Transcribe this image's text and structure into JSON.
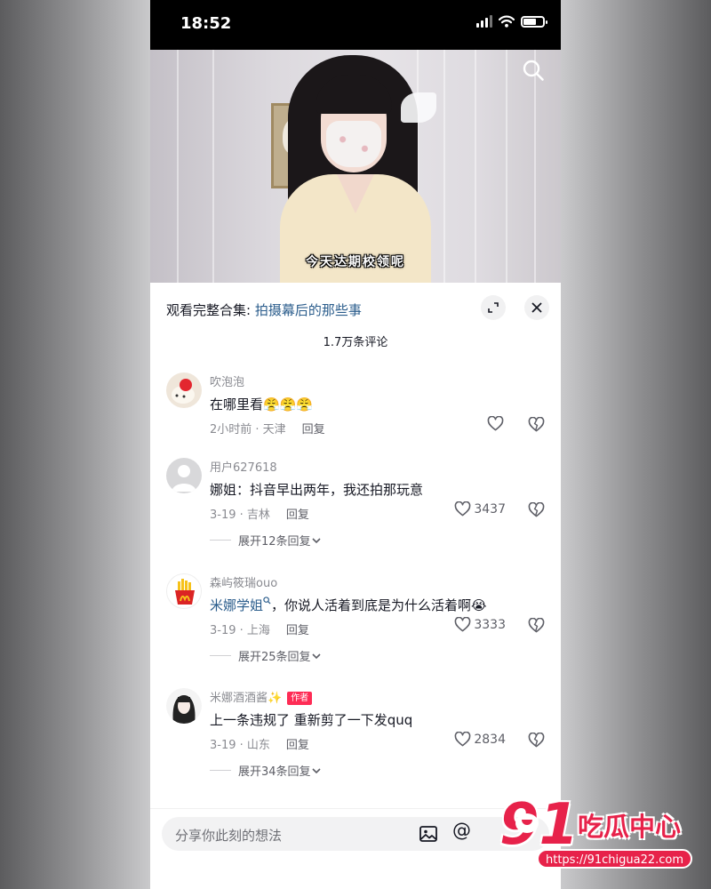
{
  "status_bar": {
    "time": "18:52"
  },
  "video": {
    "caption": "今天达期校领呢"
  },
  "panel": {
    "collection_prefix": "观看完整合集: ",
    "collection_link": "拍摄幕后的那些事",
    "comment_count": "1.7万条评论"
  },
  "comments": [
    {
      "user": "吹泡泡",
      "text": "在哪里看😤😤😤",
      "date_location": "2小时前 · 天津",
      "reply_label": "回复",
      "likes": ""
    },
    {
      "user": "用户627618",
      "text": "娜姐：抖音早出两年，我还拍那玩意",
      "date_location": "3-19 · 吉林",
      "reply_label": "回复",
      "likes": "3437",
      "expand_replies": "展开12条回复"
    },
    {
      "user": "森屿筱瑞ouo",
      "mention": "米娜学姐",
      "text": "，你说人活着到底是为什么活着啊😭",
      "date_location": "3-19 · 上海",
      "reply_label": "回复",
      "likes": "3333",
      "expand_replies": "展开25条回复"
    },
    {
      "user": "米娜酒酒酱✨",
      "badge": "作者",
      "text": "上一条违规了 重新剪了一下发quq",
      "date_location": "3-19 · 山东",
      "reply_label": "回复",
      "likes": "2834",
      "expand_replies": "展开34条回复"
    }
  ],
  "input": {
    "placeholder": "分享你此刻的想法",
    "at_symbol": "@"
  },
  "watermark": {
    "number": "91",
    "brand": "吃瓜中心",
    "url": "https://91chigua22.com"
  }
}
